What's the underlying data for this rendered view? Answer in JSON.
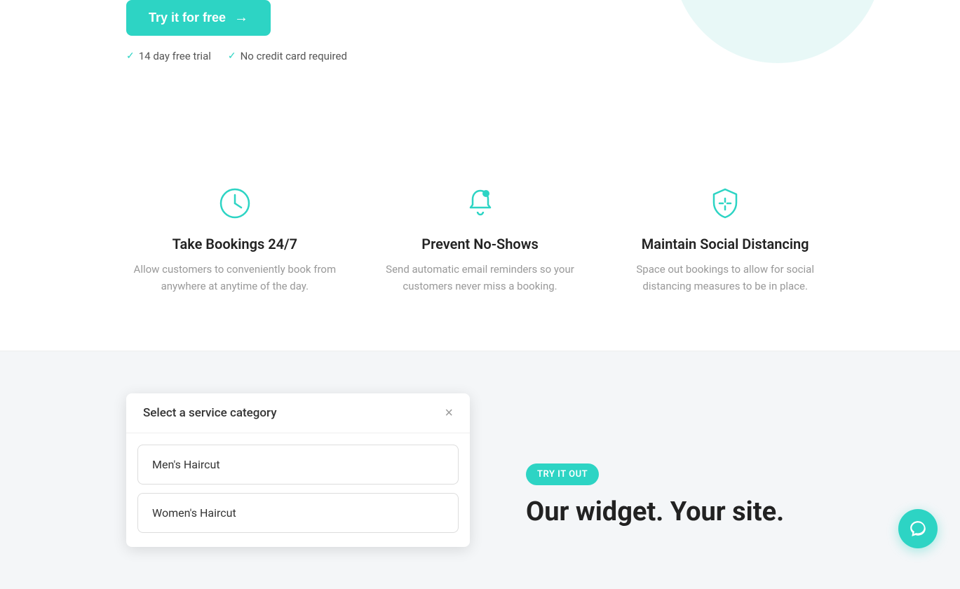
{
  "top": {
    "cta_label": "Try it for free",
    "cta_arrow": "→",
    "trial_items": [
      {
        "icon": "✓",
        "text": "14 day free trial"
      },
      {
        "icon": "✓",
        "text": "No credit card required"
      }
    ]
  },
  "features": [
    {
      "id": "bookings",
      "icon": "clock",
      "title": "Take Bookings 24/7",
      "desc": "Allow customers to conveniently book from anywhere at anytime of the day."
    },
    {
      "id": "no-shows",
      "icon": "bell",
      "title": "Prevent No-Shows",
      "desc": "Send automatic email reminders so your customers never miss a booking."
    },
    {
      "id": "distancing",
      "icon": "shield",
      "title": "Maintain Social Distancing",
      "desc": "Space out bookings to allow for social distancing measures to be in place."
    }
  ],
  "modal": {
    "title": "Select a service category",
    "close_label": "×",
    "services": [
      {
        "id": "mens-haircut",
        "label": "Men's Haircut"
      },
      {
        "id": "womens-haircut",
        "label": "Women's Haircut"
      }
    ]
  },
  "right": {
    "badge": "TRY IT OUT",
    "heading": "Our widget. Your site."
  },
  "chat": {
    "label": "chat-support"
  }
}
